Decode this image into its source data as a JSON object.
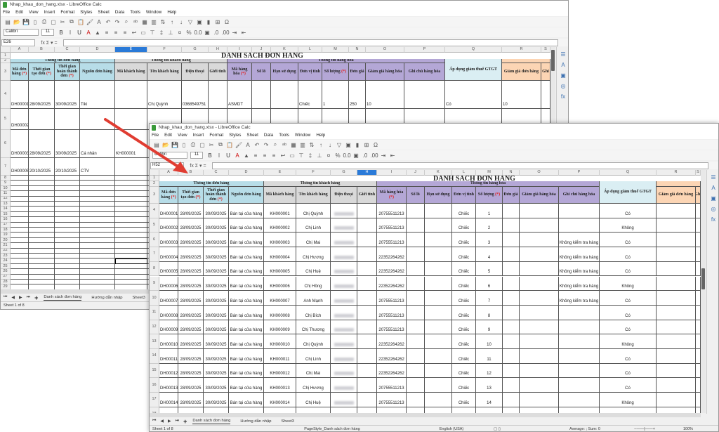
{
  "back_window": {
    "title": "Nhap_khau_don_hang.xlsx - LibreOffice Calc",
    "menu": [
      "File",
      "Edit",
      "View",
      "Insert",
      "Format",
      "Styles",
      "Sheet",
      "Data",
      "Tools",
      "Window",
      "Help"
    ],
    "font_name": "Calibri",
    "font_size": "11",
    "name_box": "E26",
    "fx_label": "fx Σ ▾ =",
    "sheet_title": "DANH SÁCH ĐƠN HÀNG",
    "rows": [
      [
        "DH00001",
        "28/09/2025",
        "30/09/2025",
        "Tiki",
        "",
        "Chị Quỳnh",
        "0368549751",
        "",
        "ASMDT",
        "",
        "",
        "Chiếc",
        "1",
        "250",
        "10",
        "",
        "Có",
        "10",
        ""
      ],
      [
        "DH00002",
        "",
        "",
        "",
        "",
        "",
        "",
        "",
        "",
        "",
        "",
        "",
        "",
        "",
        "",
        "",
        "",
        "",
        ""
      ],
      [
        "DH00003",
        "28/09/2025",
        "30/09/2025",
        "Cá nhân",
        "KH000001",
        "",
        "",
        "",
        "",
        "",
        "",
        "",
        "",
        "",
        "",
        "",
        "",
        "",
        ""
      ],
      [
        "DH00005",
        "20/10/2025",
        "20/10/2025",
        "CTV",
        "",
        "",
        "",
        "",
        "",
        "",
        "",
        "",
        "",
        "",
        "",
        "",
        "",
        "",
        ""
      ]
    ],
    "tabs": [
      "Danh sách đơn hàng",
      "Hướng dẫn nhập",
      "Sheet3"
    ],
    "status_sheet": "Sheet 1 of 8"
  },
  "front_window": {
    "title": "Nhap_khau_don_hang.xlsx - LibreOffice Calc",
    "menu": [
      "File",
      "Edit",
      "View",
      "Insert",
      "Format",
      "Styles",
      "Sheet",
      "Data",
      "Tools",
      "Window",
      "Help"
    ],
    "font_name": "Calibri",
    "font_size": "11",
    "name_box": "H52",
    "fx_label": "fx Σ ▾ =",
    "sheet_title": "DANH SÁCH ĐƠN HÀNG",
    "rows": [
      [
        "DH00001",
        "28/09/2025",
        "30/09/2025",
        "Bán tại cửa hàng",
        "KH000001",
        "Chị Quỳnh",
        "",
        "",
        "20755511213",
        "",
        "",
        "Chiếc",
        "1",
        "",
        "",
        "",
        "Có",
        "",
        ""
      ],
      [
        "DH00002",
        "28/09/2025",
        "30/09/2025",
        "Bán tại cửa hàng",
        "KH000002",
        "Chị Linh",
        "",
        "",
        "20755511213",
        "",
        "",
        "Chiếc",
        "2",
        "",
        "",
        "",
        "Không",
        "",
        ""
      ],
      [
        "DH00003",
        "28/09/2025",
        "30/09/2025",
        "Bán tại cửa hàng",
        "KH000003",
        "Chị Mai",
        "",
        "",
        "20755511213",
        "",
        "",
        "Chiếc",
        "3",
        "",
        "",
        "Không kiểm tra hàng",
        "Có",
        "",
        ""
      ],
      [
        "DH00004",
        "28/09/2025",
        "30/09/2025",
        "Bán tại cửa hàng",
        "KH000004",
        "Chị Hương",
        "",
        "",
        "22352264262",
        "",
        "",
        "Chiếc",
        "4",
        "",
        "",
        "Không kiểm tra hàng",
        "Có",
        "",
        ""
      ],
      [
        "DH00005",
        "28/09/2025",
        "30/09/2025",
        "Bán tại cửa hàng",
        "KH000005",
        "Chị Huệ",
        "",
        "",
        "22352264262",
        "",
        "",
        "Chiếc",
        "5",
        "",
        "",
        "Không kiểm tra hàng",
        "Có",
        "",
        ""
      ],
      [
        "DH00006",
        "28/09/2025",
        "30/09/2025",
        "Bán tại cửa hàng",
        "KH000006",
        "Chị Hồng",
        "",
        "",
        "22352264262",
        "",
        "",
        "Chiếc",
        "6",
        "",
        "",
        "Không kiểm tra hàng",
        "Không",
        "",
        ""
      ],
      [
        "DH00007",
        "28/09/2025",
        "30/09/2025",
        "Bán tại cửa hàng",
        "KH000007",
        "Anh Mạnh",
        "",
        "",
        "20755511213",
        "",
        "",
        "Chiếc",
        "7",
        "",
        "",
        "Không kiểm tra hàng",
        "Có",
        "",
        ""
      ],
      [
        "DH00008",
        "28/09/2025",
        "30/09/2025",
        "Bán tại cửa hàng",
        "KH000008",
        "Chị Bích",
        "",
        "",
        "20755511213",
        "",
        "",
        "Chiếc",
        "8",
        "",
        "",
        "",
        "Có",
        "",
        ""
      ],
      [
        "DH00009",
        "28/09/2025",
        "30/09/2025",
        "Bán tại cửa hàng",
        "KH000009",
        "Chị Thương",
        "",
        "",
        "20755511213",
        "",
        "",
        "Chiếc",
        "9",
        "",
        "",
        "",
        "Có",
        "",
        ""
      ],
      [
        "DH00010",
        "28/09/2025",
        "30/09/2025",
        "Bán tại cửa hàng",
        "KH000010",
        "Chị Quỳnh",
        "",
        "",
        "22352264262",
        "",
        "",
        "Chiếc",
        "10",
        "",
        "",
        "",
        "Không",
        "",
        ""
      ],
      [
        "DH00011",
        "28/09/2025",
        "30/09/2025",
        "Bán tại cửa hàng",
        "KH000011",
        "Chị Linh",
        "",
        "",
        "22352264262",
        "",
        "",
        "Chiếc",
        "11",
        "",
        "",
        "",
        "Có",
        "",
        ""
      ],
      [
        "DH00012",
        "28/09/2025",
        "30/09/2025",
        "Bán tại cửa hàng",
        "KH000012",
        "Chị Mai",
        "",
        "",
        "22352264262",
        "",
        "",
        "Chiếc",
        "12",
        "",
        "",
        "",
        "Có",
        "",
        ""
      ],
      [
        "DH00013",
        "28/09/2025",
        "30/09/2025",
        "Bán tại cửa hàng",
        "KH000013",
        "Chị Hương",
        "",
        "",
        "20755511213",
        "",
        "",
        "Chiếc",
        "13",
        "",
        "",
        "",
        "Có",
        "",
        ""
      ],
      [
        "DH00014",
        "28/09/2025",
        "30/09/2025",
        "Bán tại cửa hàng",
        "KH000014",
        "Chị Huệ",
        "",
        "",
        "20755511213",
        "",
        "",
        "Chiếc",
        "14",
        "",
        "",
        "",
        "Không",
        "",
        ""
      ]
    ],
    "tabs": [
      "Danh sách đơn hàng",
      "Hướng dẫn nhập",
      "Sheet3"
    ],
    "status_sheet": "Sheet 1 of 8",
    "status_pagestyle": "PageStyle_Danh sách đơn hàng",
    "status_language": "English (USA)",
    "status_sum": "Average: ; Sum: 0",
    "zoom": "100%"
  },
  "columns": [
    "A",
    "B",
    "C",
    "D",
    "E",
    "F",
    "G",
    "H",
    "I",
    "J",
    "K",
    "L",
    "M",
    "N",
    "O",
    "P",
    "Q",
    "R",
    "S"
  ],
  "groups": [
    {
      "label": "Thông tin đơn hàng",
      "from": 0,
      "span": 4,
      "color": "#b7dde8"
    },
    {
      "label": "Thông tin khách hàng",
      "from": 4,
      "span": 4,
      "color": "#d9d9d9"
    },
    {
      "label": "Thông tin hàng hóa",
      "from": 8,
      "span": 8,
      "color": "#b4a7d6"
    },
    {
      "label": "",
      "from": 17,
      "span": 2,
      "color": "#fcd5b4"
    }
  ],
  "headers": [
    {
      "text": "Mã đơn hàng",
      "req": true,
      "color": "#b7dde8"
    },
    {
      "text": "Thời gian tạo đơn",
      "req": true,
      "color": "#b7dde8"
    },
    {
      "text": "Thời gian hoàn thành đơn",
      "req": true,
      "color": "#b7dde8"
    },
    {
      "text": "Nguồn đơn hàng",
      "req": false,
      "color": "#b7dde8"
    },
    {
      "text": "Mã khách hàng",
      "req": false,
      "color": "#d9d9d9"
    },
    {
      "text": "Tên khách hàng",
      "req": false,
      "color": "#d9d9d9"
    },
    {
      "text": "Điện thoại",
      "req": false,
      "color": "#d9d9d9"
    },
    {
      "text": "Giới tính",
      "req": false,
      "color": "#d9d9d9"
    },
    {
      "text": "Mã hàng hóa",
      "req": true,
      "color": "#b4a7d6"
    },
    {
      "text": "Số lô",
      "req": false,
      "color": "#b4a7d6"
    },
    {
      "text": "Hạn sử dụng",
      "req": false,
      "color": "#b4a7d6"
    },
    {
      "text": "Đơn vị tính",
      "req": false,
      "color": "#b4a7d6"
    },
    {
      "text": "Số lượng",
      "req": true,
      "color": "#b4a7d6"
    },
    {
      "text": "Đơn giá",
      "req": false,
      "color": "#b4a7d6"
    },
    {
      "text": "Giảm giá hàng hóa",
      "req": false,
      "color": "#b4a7d6"
    },
    {
      "text": "Ghi chú hàng hóa",
      "req": false,
      "color": "#b4a7d6"
    },
    {
      "text": "Áp dụng giảm thuế GTGT",
      "req": false,
      "color": "#daeef3"
    },
    {
      "text": "Giảm giá đơn hàng",
      "req": false,
      "color": "#fcd5b4"
    },
    {
      "text": "Ghi",
      "req": false,
      "color": "#fcd5b4"
    }
  ],
  "required_mark": "(*)",
  "toolbar1_icons": [
    "new-icon",
    "open-icon",
    "save-icon",
    "export-pdf-icon",
    "print-icon",
    "print-preview-icon",
    "cut-icon",
    "copy-icon",
    "paste-icon",
    "clone-format-icon",
    "clear-format-icon",
    "undo-icon",
    "redo-icon",
    "find-replace-icon",
    "spelling-icon",
    "row-icon",
    "column-icon",
    "sort-icon",
    "sort-ascending-icon",
    "sort-descending-icon",
    "autofilter-icon",
    "image-icon",
    "chart-icon",
    "pivot-table-icon",
    "special-character-icon"
  ],
  "toolbar2_icons": [
    "bold-icon",
    "italic-icon",
    "underline-icon",
    "font-color-icon",
    "highlight-icon",
    "align-left-icon",
    "align-center-icon",
    "align-right-icon",
    "wrap-icon",
    "merge-icon",
    "align-top-icon",
    "align-middle-icon",
    "align-bottom-icon",
    "currency-icon",
    "percent-icon",
    "number-icon",
    "date-icon",
    "add-decimal-icon",
    "delete-decimal-icon",
    "increase-indent-icon",
    "decrease-indent-icon"
  ],
  "arrow_color": "#e03c31"
}
